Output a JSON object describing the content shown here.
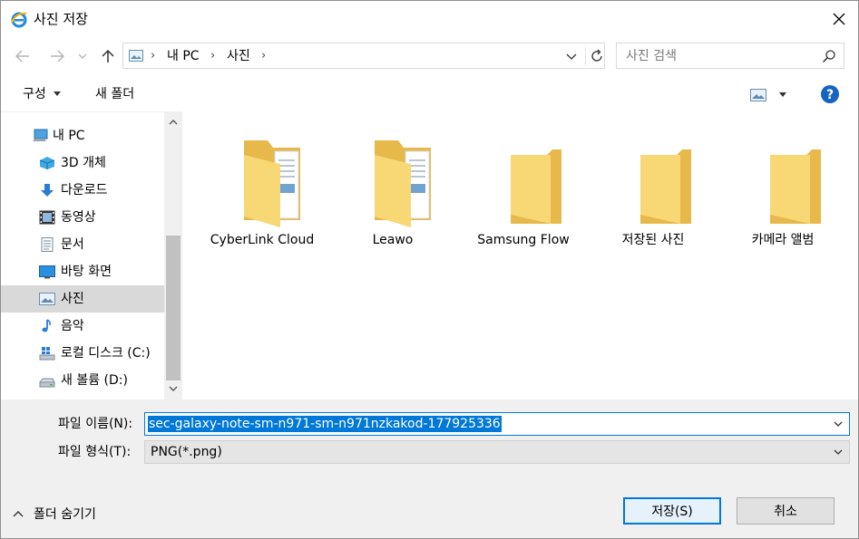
{
  "window": {
    "title": "사진 저장"
  },
  "address": {
    "crumbs": [
      "내 PC",
      "사진"
    ]
  },
  "search": {
    "placeholder": "사진 검색"
  },
  "commands": {
    "organize": "구성",
    "new_folder": "새 폴더"
  },
  "nav": {
    "items": [
      {
        "label": "내 PC",
        "icon": "computer-icon"
      },
      {
        "label": "3D 개체",
        "icon": "3d-objects-icon"
      },
      {
        "label": "다운로드",
        "icon": "download-icon"
      },
      {
        "label": "동영상",
        "icon": "video-icon"
      },
      {
        "label": "문서",
        "icon": "document-icon"
      },
      {
        "label": "바탕 화면",
        "icon": "desktop-icon"
      },
      {
        "label": "사진",
        "icon": "pictures-icon",
        "selected": true
      },
      {
        "label": "음악",
        "icon": "music-icon"
      },
      {
        "label": "로컬 디스크 (C:)",
        "icon": "windows-drive-icon"
      },
      {
        "label": "새 볼륨 (D:)",
        "icon": "drive-icon"
      }
    ]
  },
  "files": [
    {
      "name": "CyberLink Cloud",
      "icon": "folder-with-files-icon"
    },
    {
      "name": "Leawo",
      "icon": "folder-with-files-icon"
    },
    {
      "name": "Samsung Flow",
      "icon": "folder-icon"
    },
    {
      "name": "저장된 사진",
      "icon": "folder-icon"
    },
    {
      "name": "카메라 앨범",
      "icon": "folder-icon"
    }
  ],
  "form": {
    "filename_label": "파일 이름(N):",
    "filename_value": "sec-galaxy-note-sm-n971-sm-n971nzkakod-177925336",
    "filetype_label": "파일 형식(T):",
    "filetype_value": "PNG(*.png)"
  },
  "footer": {
    "hide_folders": "폴더 숨기기",
    "save": "저장(S)",
    "cancel": "취소"
  },
  "colors": {
    "accent": "#0078d7",
    "folder": "#f8d775",
    "selection": "#d9d9d9"
  }
}
